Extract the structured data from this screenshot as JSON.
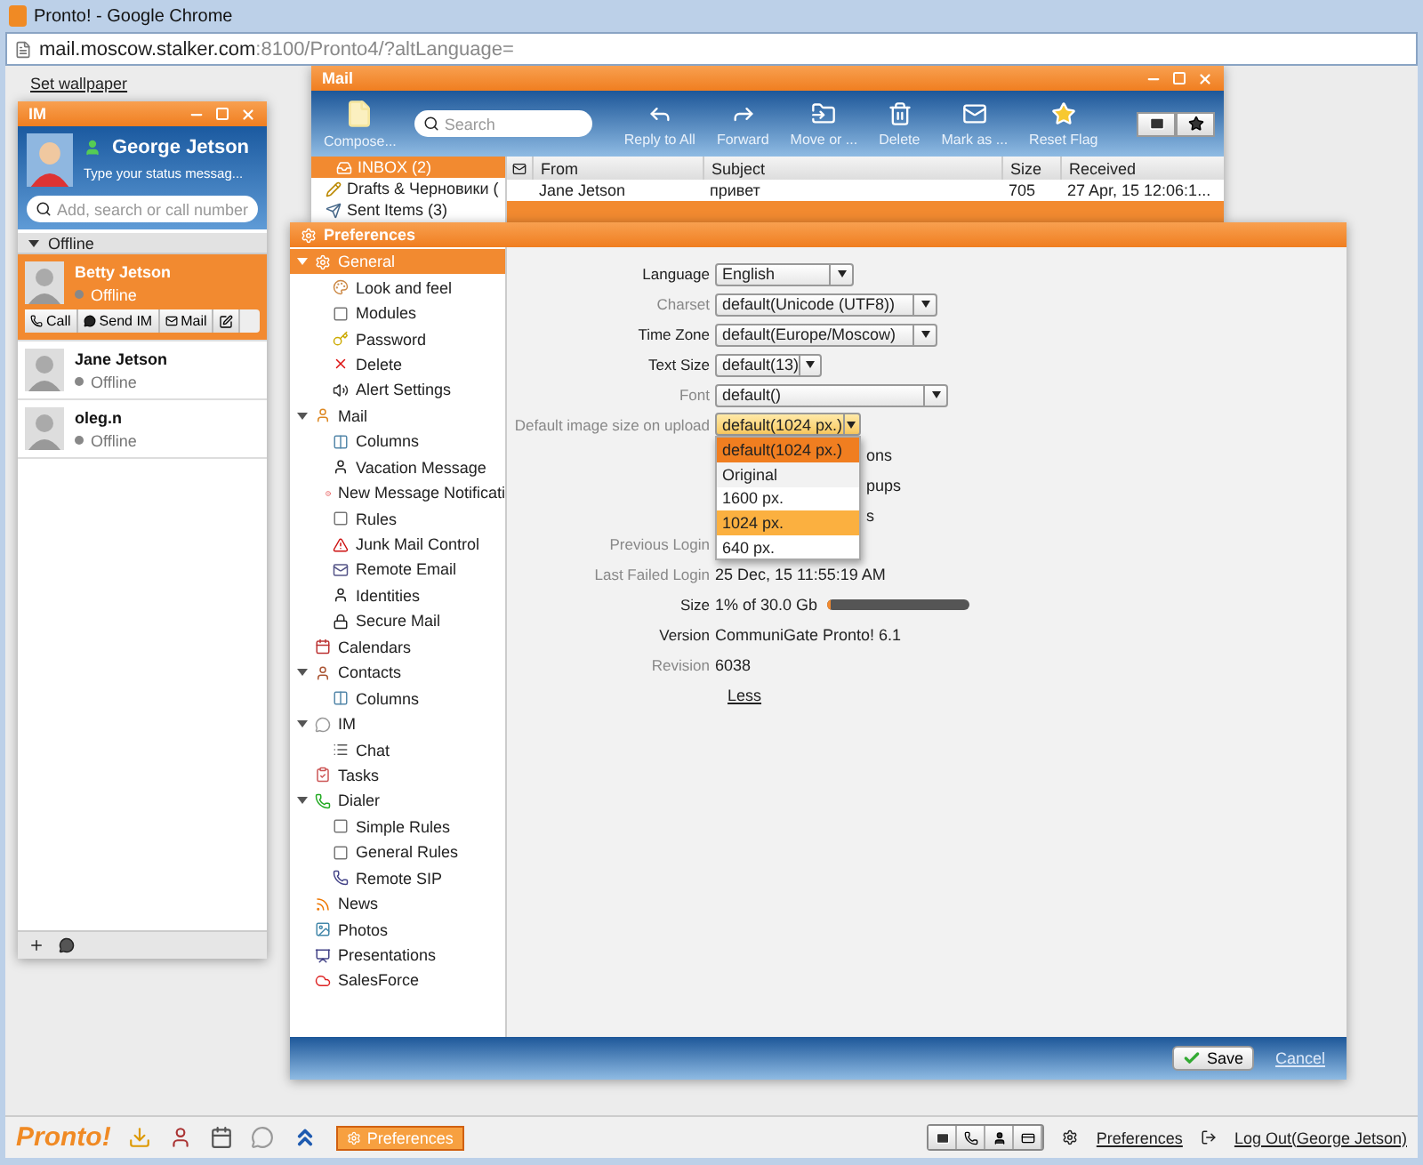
{
  "browser": {
    "title": "Pronto! - Google Chrome",
    "url_host": "mail.moscow.stalker.com",
    "url_path": ":8100/Pronto4/?altLanguage="
  },
  "desktop": {
    "wallpaper_link": "Set wallpaper"
  },
  "im": {
    "title": "IM",
    "user": {
      "name": "George Jetson",
      "status_message": "Type your status messag..."
    },
    "search": {
      "placeholder": "Add, search or call number"
    },
    "group": {
      "label": "Offline",
      "expanded": true
    },
    "contacts": [
      {
        "name": "Betty Jetson",
        "status": "Offline",
        "selected": true
      },
      {
        "name": "Jane Jetson",
        "status": "Offline",
        "selected": false
      },
      {
        "name": "oleg.n",
        "status": "Offline",
        "selected": false
      }
    ],
    "contact_actions": [
      "Call",
      "Send IM",
      "Mail"
    ]
  },
  "mail": {
    "title": "Mail",
    "compose": "Compose...",
    "search": {
      "placeholder": "Search"
    },
    "toolbar": [
      "Reply to All",
      "Forward",
      "Move or ...",
      "Delete",
      "Mark as ...",
      "Reset Flag"
    ],
    "folders": [
      {
        "label": "INBOX (2)",
        "selected": true
      },
      {
        "label": "Drafts & Черновики (",
        "selected": false
      },
      {
        "label": "Sent Items (3)",
        "selected": false
      }
    ],
    "columns": [
      "From",
      "Subject",
      "Size",
      "Received"
    ],
    "rows": [
      {
        "from": "Jane Jetson",
        "subject": "привет",
        "size": "705",
        "received": "27 Apr, 15 12:06:1...",
        "selected": false
      },
      {
        "selected": true
      }
    ]
  },
  "preferences": {
    "title": "Preferences",
    "tree": [
      {
        "label": "General",
        "selected": true,
        "expanded": true,
        "children": [
          {
            "label": "Look and feel",
            "selected": false
          },
          {
            "label": "Modules",
            "selected": false
          },
          {
            "label": "Password",
            "selected": false
          },
          {
            "label": "Delete",
            "selected": false
          },
          {
            "label": "Alert Settings",
            "selected": false
          }
        ]
      },
      {
        "label": "Mail",
        "selected": false,
        "expanded": true,
        "children": [
          {
            "label": "Columns",
            "selected": false
          },
          {
            "label": "Vacation Message",
            "selected": false
          },
          {
            "label": "New Message Notificati",
            "selected": false
          },
          {
            "label": "Rules",
            "selected": false
          },
          {
            "label": "Junk Mail Control",
            "selected": false
          },
          {
            "label": "Remote Email",
            "selected": false
          },
          {
            "label": "Identities",
            "selected": false
          },
          {
            "label": "Secure Mail",
            "selected": false
          }
        ]
      },
      {
        "label": "Calendars",
        "selected": false
      },
      {
        "label": "Contacts",
        "selected": false,
        "expanded": true,
        "children": [
          {
            "label": "Columns",
            "selected": false
          }
        ]
      },
      {
        "label": "IM",
        "selected": false,
        "expanded": true,
        "children": [
          {
            "label": "Chat",
            "selected": false
          }
        ]
      },
      {
        "label": "Tasks",
        "selected": false
      },
      {
        "label": "Dialer",
        "selected": false,
        "expanded": true,
        "children": [
          {
            "label": "Simple Rules",
            "selected": false
          },
          {
            "label": "General Rules",
            "selected": false
          },
          {
            "label": "Remote SIP",
            "selected": false
          }
        ]
      },
      {
        "label": "News",
        "selected": false
      },
      {
        "label": "Photos",
        "selected": false
      },
      {
        "label": "Presentations",
        "selected": false
      },
      {
        "label": "SalesForce",
        "selected": false
      }
    ],
    "settings": [
      {
        "kind": "select",
        "label": "Language",
        "value": "English",
        "dimmed": false
      },
      {
        "kind": "select",
        "label": "Charset",
        "value": "default(Unicode (UTF8))",
        "dimmed": true
      },
      {
        "kind": "select",
        "label": "Time Zone",
        "value": "default(Europe/Moscow)",
        "dimmed": false
      },
      {
        "kind": "select",
        "label": "Text Size",
        "value": "default(13)",
        "dimmed": false
      },
      {
        "kind": "select",
        "label": "Font",
        "value": "default()",
        "dimmed": true
      },
      {
        "kind": "select",
        "label": "Default image size on upload",
        "value": "default(1024 px.)",
        "dimmed": true,
        "open": true,
        "options": [
          {
            "label": "default(1024 px.)",
            "selected": true,
            "hovered": false
          },
          {
            "label": "Original",
            "selected": false,
            "hovered": false
          },
          {
            "label": "1600 px.",
            "selected": false,
            "hovered": false
          },
          {
            "label": "1024 px.",
            "selected": false,
            "hovered": true
          },
          {
            "label": "640 px.",
            "selected": false,
            "hovered": false
          }
        ]
      },
      {
        "kind": "covered",
        "value": "ons"
      },
      {
        "kind": "covered",
        "value": "pups"
      },
      {
        "kind": "covered",
        "value": "s"
      },
      {
        "kind": "text",
        "label": "Previous Login",
        "dimmed": true
      },
      {
        "kind": "text",
        "label": "Last Failed Login",
        "value": "25 Dec, 15 11:55:19 AM",
        "dimmed": true
      },
      {
        "kind": "meter",
        "label": "Size",
        "value": "1% of 30.0 Gb",
        "level": 0.01,
        "dimmed": false
      },
      {
        "kind": "text",
        "label": "Version",
        "value": "CommuniGate Pronto! 6.1",
        "dimmed": false
      },
      {
        "kind": "text",
        "label": "Revision",
        "value": "6038",
        "dimmed": true
      },
      {
        "kind": "link",
        "value": "Less"
      }
    ],
    "save": "Save",
    "cancel": "Cancel"
  },
  "taskbar": {
    "logo": "Pronto!",
    "tasks": [
      {
        "label": "Preferences",
        "selected": true
      }
    ],
    "links": [
      {
        "kind": "settings",
        "label": "Preferences"
      },
      {
        "kind": "logout",
        "label": "Log Out(George Jetson)"
      }
    ]
  }
}
